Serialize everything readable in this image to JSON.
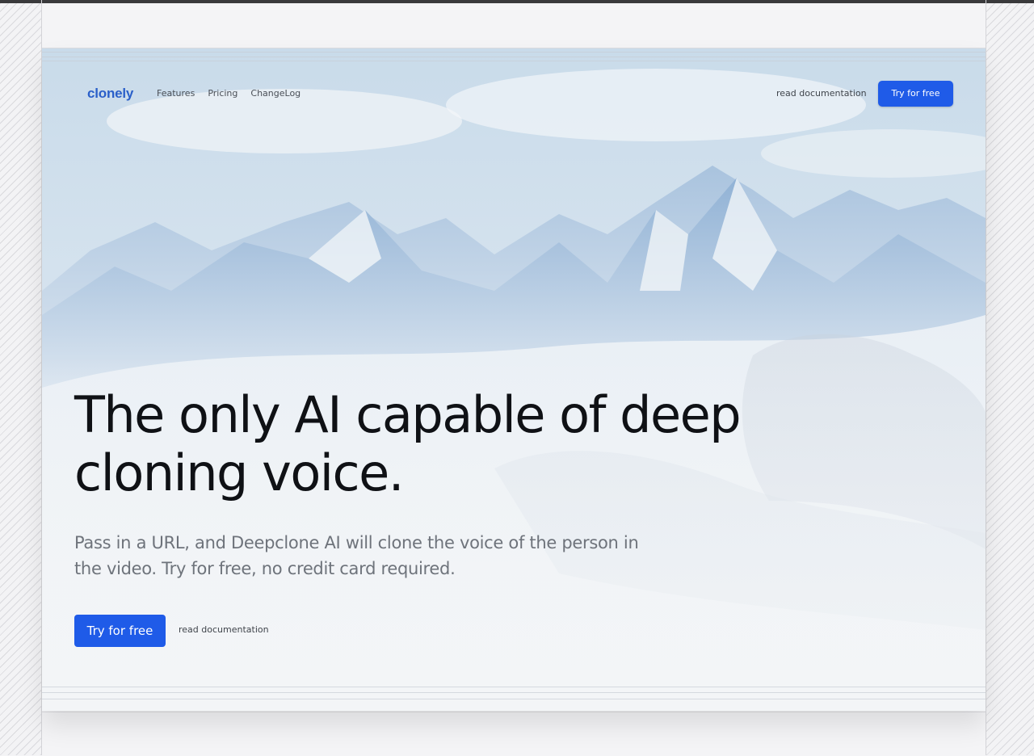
{
  "nav": {
    "logo": "clonely",
    "links": [
      "Features",
      "Pricing",
      "ChangeLog"
    ],
    "doc_link": "read documentation",
    "cta": "Try for free"
  },
  "hero": {
    "headline": "The only AI capable of deep cloning voice.",
    "subtitle": "Pass in a URL, and Deepclone AI will clone the voice of the person in the video. Try for free, no credit card required.",
    "cta": "Try for free",
    "doc_link": "read documentation"
  },
  "colors": {
    "accent": "#1f5be8",
    "logo": "#2a5fc9",
    "headline": "#0f1115",
    "subtitle": "#6e737b"
  }
}
